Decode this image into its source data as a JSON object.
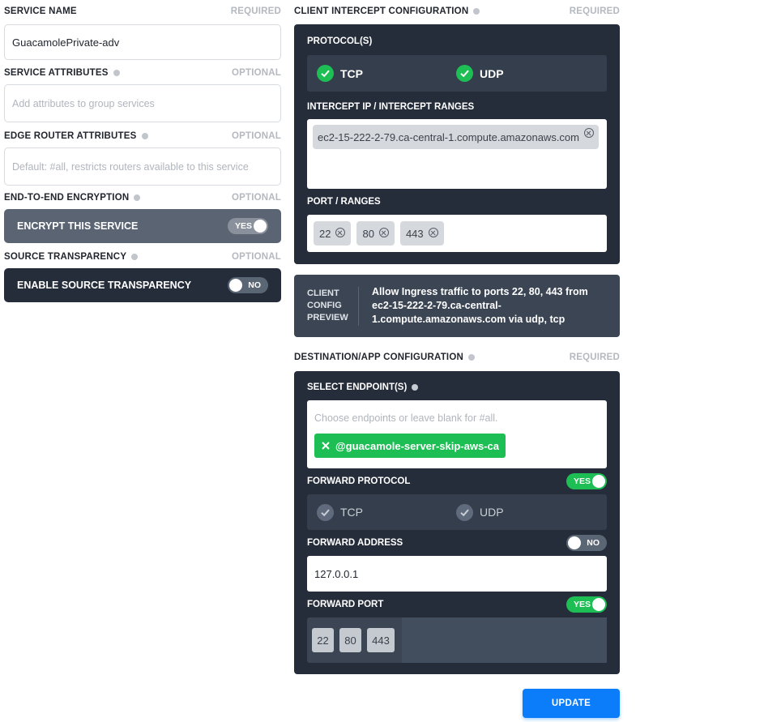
{
  "service_name": {
    "label": "SERVICE NAME",
    "req": "REQUIRED",
    "value": "GuacamolePrivate-adv"
  },
  "service_attributes": {
    "label": "SERVICE ATTRIBUTES",
    "req": "OPTIONAL",
    "placeholder": "Add attributes to group services"
  },
  "edge_router_attributes": {
    "label": "EDGE ROUTER ATTRIBUTES",
    "req": "OPTIONAL",
    "placeholder": "Default: #all, restricts routers available to this service"
  },
  "encryption": {
    "label": "END-TO-END ENCRYPTION",
    "req": "OPTIONAL",
    "toggle_label": "ENCRYPT THIS SERVICE",
    "state": "YES"
  },
  "source_transparency": {
    "label": "SOURCE TRANSPARENCY",
    "req": "OPTIONAL",
    "toggle_label": "ENABLE SOURCE TRANSPARENCY",
    "state": "NO"
  },
  "client_intercept": {
    "label": "CLIENT INTERCEPT CONFIGURATION",
    "req": "REQUIRED",
    "protocols_label": "PROTOCOL(S)",
    "protocols": [
      {
        "label": "TCP",
        "checked": true
      },
      {
        "label": "UDP",
        "checked": true
      }
    ],
    "intercept_label": "INTERCEPT IP / INTERCEPT RANGES",
    "intercept_chip": "ec2-15-222-2-79.ca-central-1.compute.amazonaws.com",
    "ports_label": "PORT / RANGES",
    "ports": [
      "22",
      "80",
      "443"
    ]
  },
  "preview": {
    "label_line1": "CLIENT",
    "label_line2": "CONFIG",
    "label_line3": "PREVIEW",
    "text": "Allow Ingress traffic to ports 22, 80, 443 from ec2-15-222-2-79.ca-central-1.compute.amazonaws.com via udp, tcp"
  },
  "destination": {
    "label": "DESTINATION/APP CONFIGURATION",
    "req": "REQUIRED",
    "endpoints_label": "SELECT ENDPOINT(S)",
    "endpoints_placeholder": "Choose endpoints or leave blank for #all.",
    "endpoint_chip": "@guacamole-server-skip-aws-ca",
    "forward_protocol_label": "FORWARD PROTOCOL",
    "forward_protocol_state": "YES",
    "forward_protocols": [
      {
        "label": "TCP"
      },
      {
        "label": "UDP"
      }
    ],
    "forward_address_label": "FORWARD ADDRESS",
    "forward_address_state": "NO",
    "forward_address_value": "127.0.0.1",
    "forward_port_label": "FORWARD PORT",
    "forward_port_state": "YES",
    "forward_ports": [
      "22",
      "80",
      "443"
    ]
  },
  "update_button": "UPDATE",
  "colors": {
    "accent_green": "#1dbf54",
    "panel_dark": "#252d3a",
    "button_blue": "#0b7dfa"
  }
}
